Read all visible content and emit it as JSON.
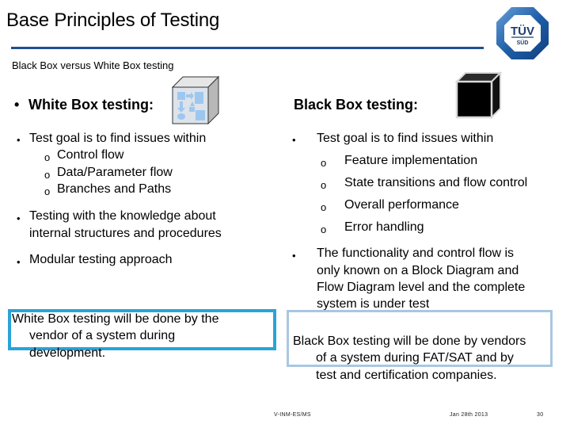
{
  "slide": {
    "title": "Base Principles of Testing",
    "subtitle": "Black Box versus White Box testing",
    "colors": {
      "rule": "#1f4e94",
      "white_box_border": "#2aa3d8",
      "black_box_border": "#a9c7e2",
      "logo_blue": "#1f5fa8"
    }
  },
  "logo": {
    "top_text": "TÜV",
    "bottom_text": "SÜD"
  },
  "white_box": {
    "heading": "White Box testing:",
    "bullet_symbol": "•",
    "sub_symbol": "o",
    "goal": "Test goal is to find issues within",
    "goal_items": [
      "Control flow",
      "Data/Parameter flow",
      "Branches and Paths"
    ],
    "knowledge_line1": "Testing with the knowledge about",
    "knowledge_line2": "internal structures and procedures",
    "modular": "Modular testing approach",
    "conclusion_line1": "White Box testing will be done by the",
    "conclusion_line2": "vendor of a system during",
    "conclusion_line3": "development."
  },
  "black_box": {
    "heading": "Black Box testing:",
    "bullet_symbol": "•",
    "sub_symbol": "o",
    "goal": "Test goal is to find issues within",
    "goal_items": [
      "Feature implementation",
      "State transitions and flow control",
      "Overall performance",
      "Error handling"
    ],
    "functionality_lines": [
      "The functionality and control flow is",
      "only known on a Block Diagram and",
      "Flow Diagram level and the complete",
      "system is under test"
    ],
    "conclusion_line1": "Black Box testing will be done by vendors",
    "conclusion_line2": "of a system during FAT/SAT and by",
    "conclusion_line3": "test and certification companies."
  },
  "footer": {
    "department": "V-INM-ES/MS",
    "date": "Jan 28th 2013",
    "page_number": "30"
  }
}
